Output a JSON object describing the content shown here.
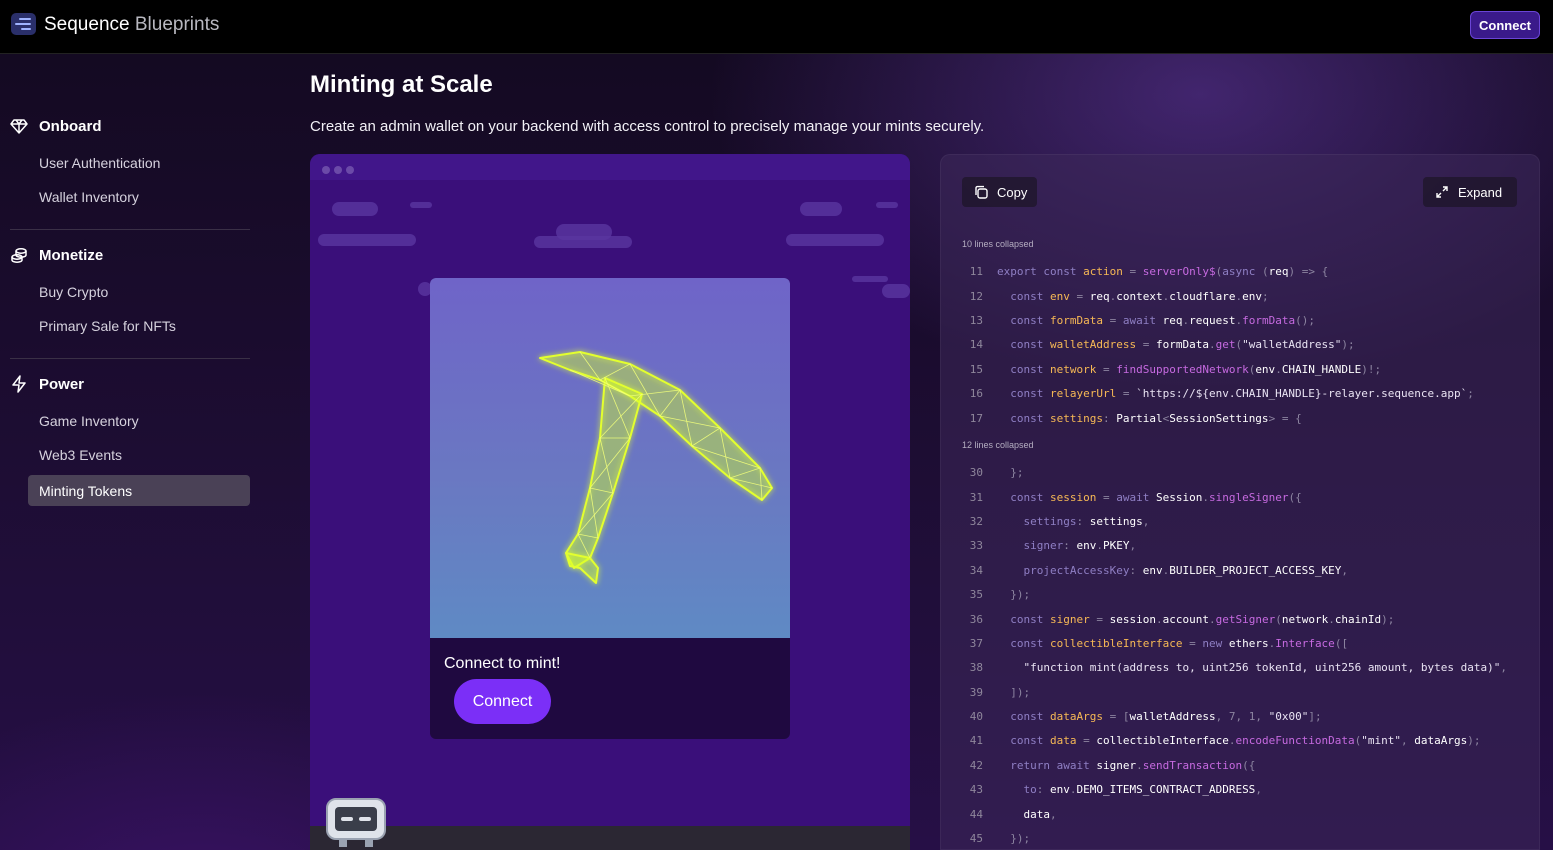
{
  "app": {
    "brand_primary": "Sequence",
    "brand_secondary": "Blueprints",
    "connect_label": "Connect"
  },
  "sidebar": {
    "sections": [
      {
        "label": "Onboard",
        "icon": "diamond-icon",
        "items": [
          "User Authentication",
          "Wallet Inventory"
        ]
      },
      {
        "label": "Monetize",
        "icon": "coins-icon",
        "items": [
          "Buy Crypto",
          "Primary Sale for NFTs"
        ]
      },
      {
        "label": "Power",
        "icon": "lightning-icon",
        "items": [
          "Game Inventory",
          "Web3 Events",
          "Minting Tokens"
        ]
      }
    ],
    "active_item": "Minting Tokens"
  },
  "page": {
    "title": "Minting at Scale",
    "subtitle": "Create an admin wallet on your backend with access control to precisely manage your mints securely."
  },
  "demo": {
    "card_label": "Connect to mint!",
    "card_button": "Connect",
    "art": "pickaxe-icon"
  },
  "code": {
    "copy_label": "Copy",
    "expand_label": "Expand",
    "collapsed_1": "10 lines collapsed",
    "collapsed_2": "12 lines collapsed",
    "lines": [
      {
        "n": "11",
        "text": "export const action = serverOnly$(async (req) => {"
      },
      {
        "n": "12",
        "text": "  const env = req.context.cloudflare.env;"
      },
      {
        "n": "13",
        "text": "  const formData = await req.request.formData();"
      },
      {
        "n": "14",
        "text": "  const walletAddress = formData.get(\"walletAddress\");"
      },
      {
        "n": "15",
        "text": "  const network = findSupportedNetwork(env.CHAIN_HANDLE)!;"
      },
      {
        "n": "16",
        "text": "  const relayerUrl = `https://${env.CHAIN_HANDLE}-relayer.sequence.app`;"
      },
      {
        "n": "17",
        "text": "  const settings: Partial<SessionSettings> = {"
      },
      {
        "n": "30",
        "text": "  };"
      },
      {
        "n": "31",
        "text": "  const session = await Session.singleSigner({"
      },
      {
        "n": "32",
        "text": "    settings: settings,"
      },
      {
        "n": "33",
        "text": "    signer: env.PKEY,"
      },
      {
        "n": "34",
        "text": "    projectAccessKey: env.BUILDER_PROJECT_ACCESS_KEY,"
      },
      {
        "n": "35",
        "text": "  });"
      },
      {
        "n": "36",
        "text": "  const signer = session.account.getSigner(network.chainId);"
      },
      {
        "n": "37",
        "text": "  const collectibleInterface = new ethers.Interface(["
      },
      {
        "n": "38",
        "text": "    \"function mint(address to, uint256 tokenId, uint256 amount, bytes data)\","
      },
      {
        "n": "39",
        "text": "  ]);"
      },
      {
        "n": "40",
        "text": "  const dataArgs = [walletAddress, 7, 1, \"0x00\"];"
      },
      {
        "n": "41",
        "text": "  const data = collectibleInterface.encodeFunctionData(\"mint\", dataArgs);"
      },
      {
        "n": "42",
        "text": "  return await signer.sendTransaction({"
      },
      {
        "n": "43",
        "text": "    to: env.DEMO_ITEMS_CONTRACT_ADDRESS,"
      },
      {
        "n": "44",
        "text": "    data,"
      },
      {
        "n": "45",
        "text": "  });"
      }
    ]
  }
}
